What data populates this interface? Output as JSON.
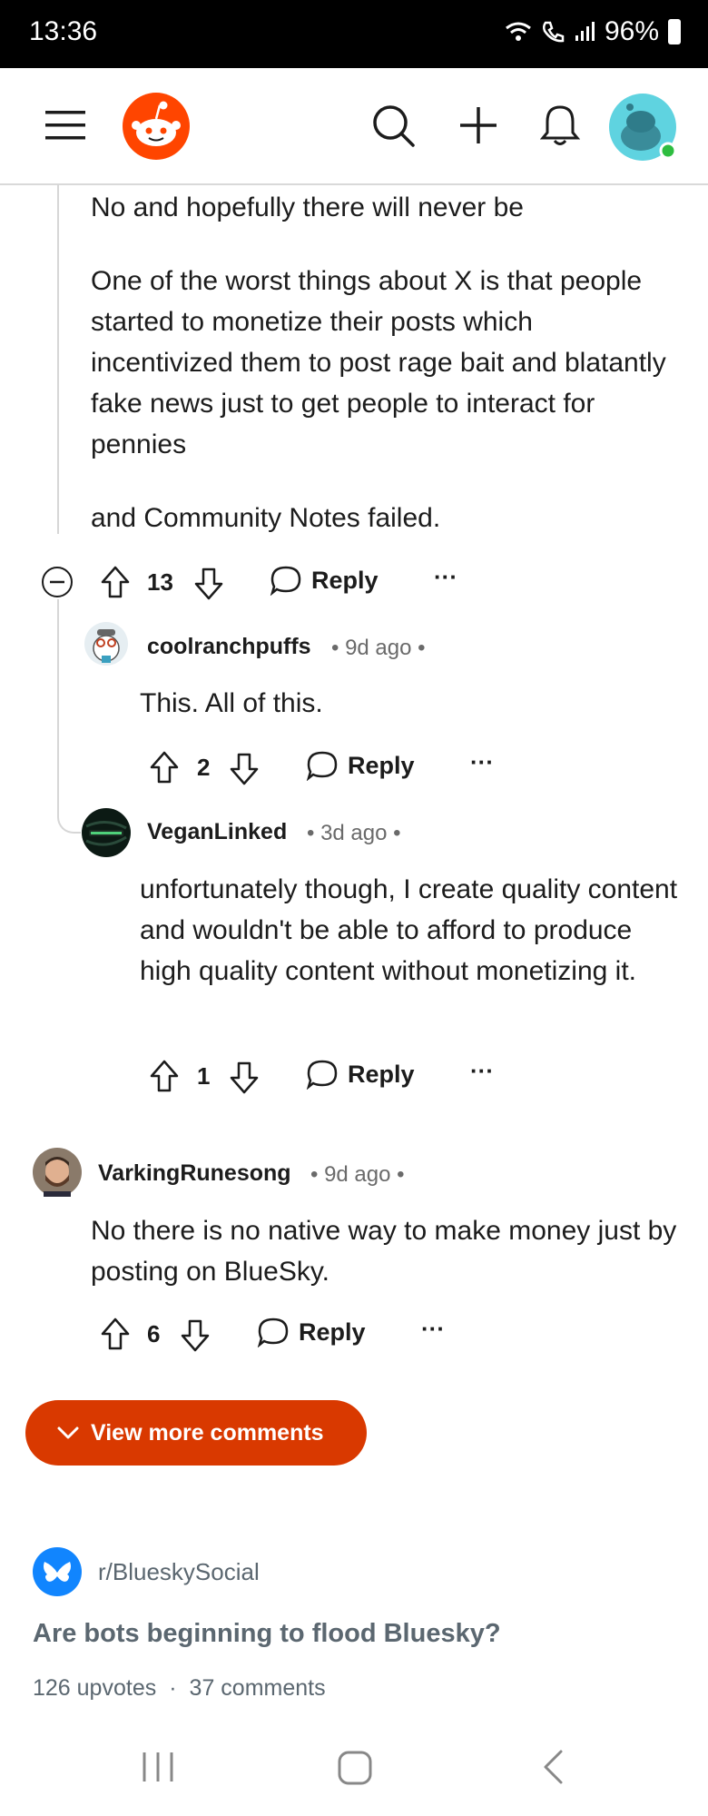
{
  "status_bar": {
    "time": "13:36",
    "battery": "96%"
  },
  "header": {
    "avatar_alt": "profile avatar"
  },
  "parent_comment": {
    "paragraphs": [
      "No and hopefully there will never be",
      "One of the worst things about X is that people started to monetize their posts which incentivized them to post rage bait and blatantly fake news just to get people to interact for pennies",
      "and Community Notes failed."
    ],
    "votes": "13",
    "reply_label": "Reply",
    "more_label": "···"
  },
  "replies": [
    {
      "username": "coolranchpuffs",
      "age": "• 9d ago •",
      "text": "This. All of this.",
      "votes": "2",
      "reply_label": "Reply",
      "more_label": "···"
    },
    {
      "username": "VeganLinked",
      "age": "• 3d ago •",
      "text": "unfortunately though, I create quality content and wouldn't be able to afford to produce high quality content without monetizing it.",
      "votes": "1",
      "reply_label": "Reply",
      "more_label": "···"
    }
  ],
  "top_comment": {
    "username": "VarkingRunesong",
    "age": "• 9d ago •",
    "text": "No there is no native way to make money just by posting on BlueSky.",
    "votes": "6",
    "reply_label": "Reply",
    "more_label": "···"
  },
  "view_more_label": "View more comments",
  "related_post": {
    "subreddit": "r/BlueskySocial",
    "title": "Are bots beginning to flood Bluesky?",
    "upvotes": "126 upvotes",
    "separator": "·",
    "comments": "37 comments"
  },
  "colors": {
    "brand": "#ff4500",
    "view_more": "#d93900",
    "bluesky": "#1185fe",
    "online": "#2ebd40"
  }
}
